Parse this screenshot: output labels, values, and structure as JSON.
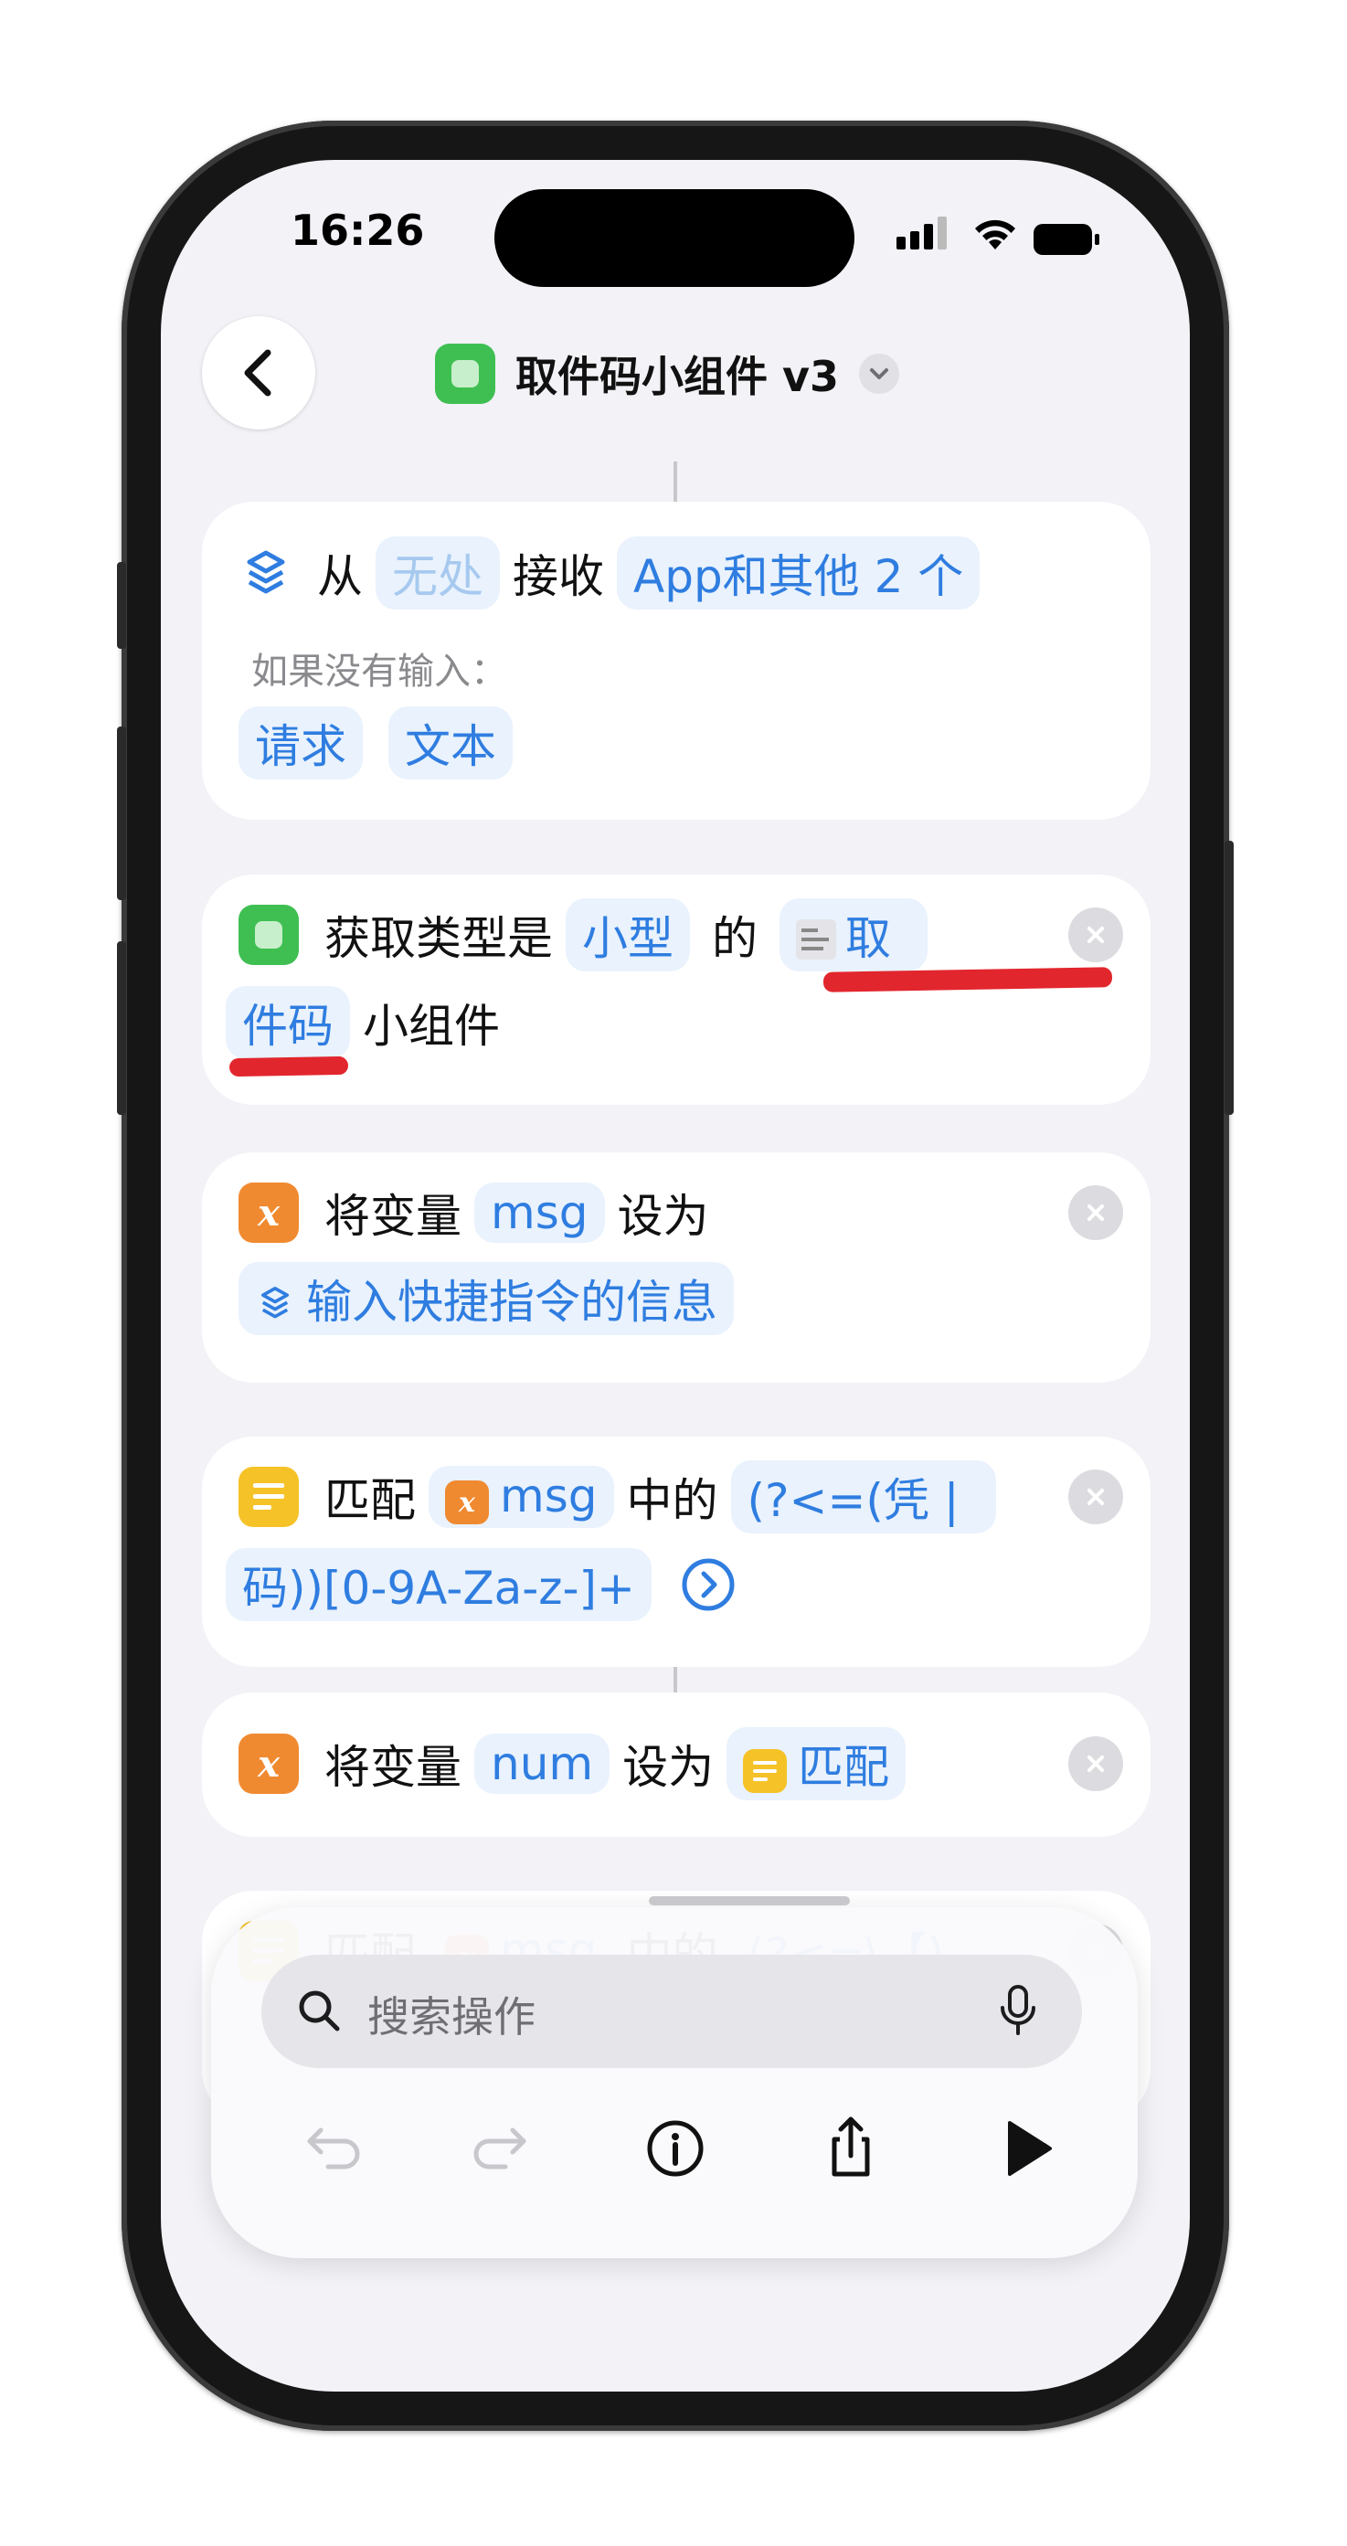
{
  "status": {
    "time": "16:26"
  },
  "header": {
    "title": "取件码小组件 v3"
  },
  "cards": {
    "receive": {
      "from": "从",
      "source": "无处",
      "receive": "接收",
      "types": "App和其他 2 个",
      "no_input_label": "如果没有输入：",
      "opt1": "请求",
      "opt2": "文本"
    },
    "widget": {
      "get_type": "获取类型是",
      "size": "小型",
      "of": "的",
      "name_line1": "取",
      "name_line2": "件码",
      "suffix": "小组件"
    },
    "setvar1": {
      "label": "将变量",
      "var": "msg",
      "set_to": "设为",
      "value": "输入快捷指令的信息"
    },
    "match1": {
      "label": "匹配",
      "var": "msg",
      "in": "中的",
      "regex_line1": "(?<=(凭 |",
      "regex_line2": "码))[0-9A-Za-z-]+"
    },
    "setvar2": {
      "label": "将变量",
      "var": "num",
      "set_to": "设为",
      "value": "匹配"
    },
    "match2": {
      "label": "匹配",
      "var": "msg",
      "in": "中的",
      "regex_line1": "(?<=\\【)"
    }
  },
  "search": {
    "placeholder": "搜索操作"
  },
  "icons": {
    "back": "chevron-left-icon",
    "receive": "shortcut-layers-icon",
    "variable": "variable-x-icon",
    "text": "text-lines-icon",
    "search": "magnifier-icon",
    "mic": "microphone-icon",
    "undo": "undo-icon",
    "redo": "redo-icon",
    "info": "info-icon",
    "share": "share-icon",
    "play": "play-icon"
  },
  "colors": {
    "accent": "#2f7de0",
    "variable": "#f08a30",
    "text_action": "#f5c228",
    "app": "#3fbf52",
    "annotation": "#e0141b"
  }
}
